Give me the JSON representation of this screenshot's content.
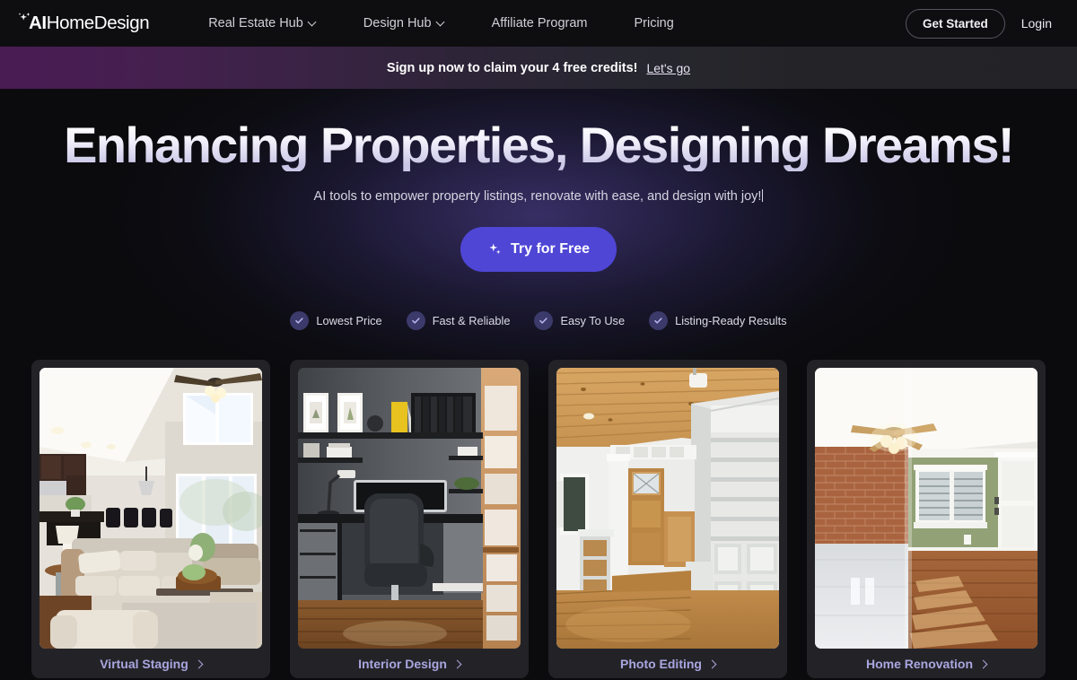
{
  "navbar": {
    "logo": {
      "bold": "AI",
      "light": "HomeDesign",
      "icon": "sparkle-icon"
    },
    "links": [
      {
        "label": "Real Estate Hub",
        "has_dropdown": true
      },
      {
        "label": "Design Hub",
        "has_dropdown": true
      },
      {
        "label": "Affiliate Program",
        "has_dropdown": false
      },
      {
        "label": "Pricing",
        "has_dropdown": false
      }
    ],
    "get_started": "Get Started",
    "login": "Login"
  },
  "promo": {
    "text": "Sign up now to claim your 4 free credits!",
    "link": "Let's go"
  },
  "hero": {
    "headline": "Enhancing Properties, Designing Dreams!",
    "subline": "AI tools to empower property listings, renovate with ease, and design with joy!",
    "cta": "Try for Free",
    "cta_icon": "sparkle-icon",
    "features": [
      {
        "label": "Lowest Price",
        "icon": "check-icon"
      },
      {
        "label": "Fast & Reliable",
        "icon": "check-icon"
      },
      {
        "label": "Easy To Use",
        "icon": "check-icon"
      },
      {
        "label": "Listing-Ready Results",
        "icon": "check-icon"
      }
    ]
  },
  "cards": [
    {
      "label": "Virtual Staging",
      "image_alt": "staged-living-room-with-high-ceiling"
    },
    {
      "label": "Interior Design",
      "image_alt": "dark-modern-home-office"
    },
    {
      "label": "Photo Editing",
      "image_alt": "room-with-white-built-in-bookshelves"
    },
    {
      "label": "Home Renovation",
      "image_alt": "before-after-brick-and-green-wall-room"
    }
  ],
  "colors": {
    "accent": "#4f46d6",
    "card_label": "#aaa6e0",
    "promo_purple": "#4a1c54",
    "page_bg": "#0b0b0e"
  }
}
